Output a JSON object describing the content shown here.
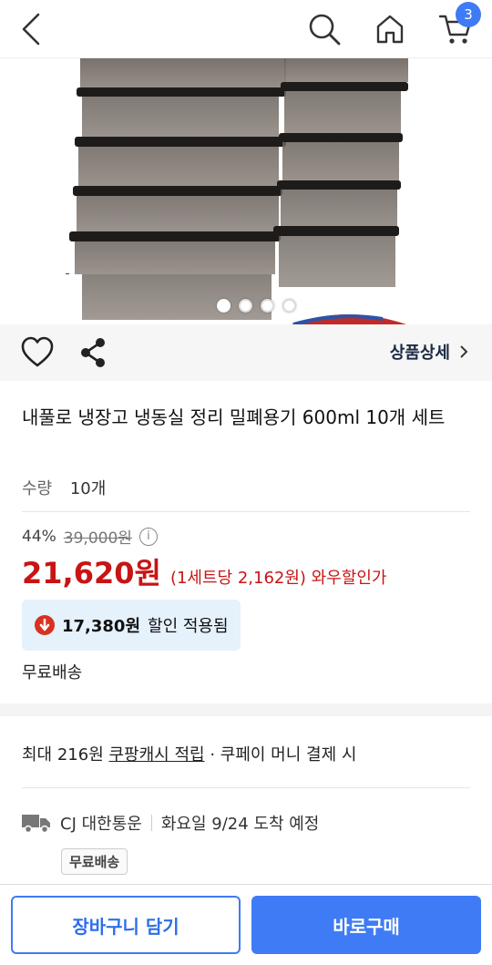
{
  "header": {
    "cart_count": "3",
    "icons": [
      "back-arrow-icon",
      "search-icon",
      "home-icon",
      "cart-icon"
    ]
  },
  "gallery": {
    "dots_total": 4,
    "active_dot": 1
  },
  "actions": {
    "detail_link": "상품상세"
  },
  "product": {
    "title": "내풀로 냉장고 냉동실 정리 밀폐용기 600ml 10개 세트",
    "qty_label": "수량",
    "qty_value": "10개",
    "discount_pct": "44%",
    "original_price": "39,000원",
    "price": "21,620원",
    "price_sub": "(1세트당 2,162원) 와우할인가",
    "applied_amount": "17,380원",
    "applied_text": "할인 적용됨",
    "shipping": "무료배송"
  },
  "cash": {
    "prefix": "최대 216원",
    "link": "쿠팡캐시 적립",
    "suffix": "· 쿠페이 머니 결제 시"
  },
  "delivery": {
    "carrier": "CJ 대한통운",
    "eta": "화요일 9/24 도착 예정",
    "badge": "무료배송"
  },
  "bottom": {
    "cart_button": "장바구니 담기",
    "buy_button": "바로구매"
  },
  "colors": {
    "accent": "#3f7bf5",
    "price_red": "#c81414"
  }
}
